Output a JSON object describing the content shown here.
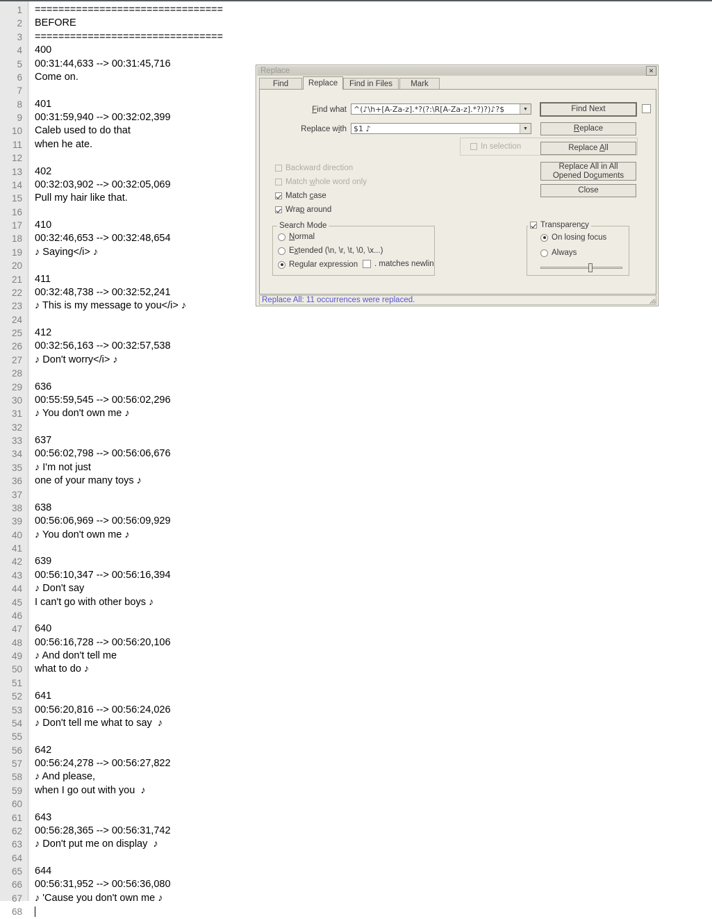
{
  "editor": {
    "lines": [
      {
        "n": 1,
        "text": "================================"
      },
      {
        "n": 2,
        "text": "BEFORE"
      },
      {
        "n": 3,
        "text": "================================"
      },
      {
        "n": 4,
        "text": "400"
      },
      {
        "n": 5,
        "text": "00:31:44,633 --> 00:31:45,716"
      },
      {
        "n": 6,
        "text": "Come on."
      },
      {
        "n": 7,
        "text": ""
      },
      {
        "n": 8,
        "text": "401"
      },
      {
        "n": 9,
        "text": "00:31:59,940 --> 00:32:02,399"
      },
      {
        "n": 10,
        "text": "Caleb used to do that"
      },
      {
        "n": 11,
        "text": "when he ate."
      },
      {
        "n": 12,
        "text": ""
      },
      {
        "n": 13,
        "text": "402"
      },
      {
        "n": 14,
        "text": "00:32:03,902 --> 00:32:05,069"
      },
      {
        "n": 15,
        "text": "Pull my hair like that."
      },
      {
        "n": 16,
        "text": ""
      },
      {
        "n": 17,
        "text": "410"
      },
      {
        "n": 18,
        "text": "00:32:46,653 --> 00:32:48,654"
      },
      {
        "n": 19,
        "text": "♪ Saying</i> ♪"
      },
      {
        "n": 20,
        "text": ""
      },
      {
        "n": 21,
        "text": "411"
      },
      {
        "n": 22,
        "text": "00:32:48,738 --> 00:32:52,241"
      },
      {
        "n": 23,
        "text": "♪ This is my message to you</i> ♪"
      },
      {
        "n": 24,
        "text": ""
      },
      {
        "n": 25,
        "text": "412"
      },
      {
        "n": 26,
        "text": "00:32:56,163 --> 00:32:57,538"
      },
      {
        "n": 27,
        "text": "♪ Don't worry</i> ♪"
      },
      {
        "n": 28,
        "text": ""
      },
      {
        "n": 29,
        "text": "636"
      },
      {
        "n": 30,
        "text": "00:55:59,545 --> 00:56:02,296"
      },
      {
        "n": 31,
        "text": "♪ You don't own me ♪"
      },
      {
        "n": 32,
        "text": ""
      },
      {
        "n": 33,
        "text": "637"
      },
      {
        "n": 34,
        "text": "00:56:02,798 --> 00:56:06,676"
      },
      {
        "n": 35,
        "text": "♪ I'm not just"
      },
      {
        "n": 36,
        "text": "one of your many toys ♪"
      },
      {
        "n": 37,
        "text": ""
      },
      {
        "n": 38,
        "text": "638"
      },
      {
        "n": 39,
        "text": "00:56:06,969 --> 00:56:09,929"
      },
      {
        "n": 40,
        "text": "♪ You don't own me ♪"
      },
      {
        "n": 41,
        "text": ""
      },
      {
        "n": 42,
        "text": "639"
      },
      {
        "n": 43,
        "text": "00:56:10,347 --> 00:56:16,394"
      },
      {
        "n": 44,
        "text": "♪ Don't say"
      },
      {
        "n": 45,
        "text": "I can't go with other boys ♪"
      },
      {
        "n": 46,
        "text": ""
      },
      {
        "n": 47,
        "text": "640"
      },
      {
        "n": 48,
        "text": "00:56:16,728 --> 00:56:20,106"
      },
      {
        "n": 49,
        "text": "♪ And don't tell me"
      },
      {
        "n": 50,
        "text": "what to do ♪"
      },
      {
        "n": 51,
        "text": ""
      },
      {
        "n": 52,
        "text": "641"
      },
      {
        "n": 53,
        "text": "00:56:20,816 --> 00:56:24,026"
      },
      {
        "n": 54,
        "text": "♪ Don't tell me what to say  ♪"
      },
      {
        "n": 55,
        "text": ""
      },
      {
        "n": 56,
        "text": "642"
      },
      {
        "n": 57,
        "text": "00:56:24,278 --> 00:56:27,822"
      },
      {
        "n": 58,
        "text": "♪ And please,"
      },
      {
        "n": 59,
        "text": "when I go out with you  ♪"
      },
      {
        "n": 60,
        "text": ""
      },
      {
        "n": 61,
        "text": "643"
      },
      {
        "n": 62,
        "text": "00:56:28,365 --> 00:56:31,742"
      },
      {
        "n": 63,
        "text": "♪ Don't put me on display  ♪"
      },
      {
        "n": 64,
        "text": ""
      },
      {
        "n": 65,
        "text": "644"
      },
      {
        "n": 66,
        "text": "00:56:31,952 --> 00:56:36,080"
      },
      {
        "n": 67,
        "text": "♪ 'Cause you don't own me ♪"
      },
      {
        "n": 68,
        "text": ""
      }
    ]
  },
  "dialog": {
    "title": "Replace",
    "close_glyph": "✕",
    "tabs": [
      {
        "label": "Find",
        "active": false
      },
      {
        "label": "Replace",
        "active": true
      },
      {
        "label": "Find in Files",
        "active": false
      },
      {
        "label": "Mark",
        "active": false
      }
    ],
    "find_what": {
      "label": "Find what",
      "value": "^(♪\\h+[A-Za-z].*?(?:\\R[A-Za-z].*?)?)♪?$",
      "arrow_glyph": "▼"
    },
    "replace_with": {
      "label": "Replace with",
      "value": "$1 ♪",
      "arrow_glyph": "▼"
    },
    "buttons": {
      "find_next": "Find Next",
      "replace": "Replace",
      "replace_all": "Replace All",
      "replace_all_opened_line1": "Replace All in All",
      "replace_all_opened_line2": "Opened Documents",
      "close": "Close"
    },
    "in_selection": {
      "label": "In selection",
      "checked": false,
      "disabled": true
    },
    "options": [
      {
        "label": "Backward direction",
        "checked": false,
        "disabled": true
      },
      {
        "label": "Match whole word only",
        "checked": false,
        "disabled": true
      },
      {
        "label": "Match case",
        "checked": true,
        "disabled": false
      },
      {
        "label": "Wrap around",
        "checked": true,
        "disabled": false
      }
    ],
    "search_mode": {
      "title": "Search Mode",
      "options": [
        {
          "label": "Normal",
          "selected": false
        },
        {
          "label": "Extended (\\n, \\r, \\t, \\0, \\x...)",
          "selected": false
        },
        {
          "label": "Regular expression",
          "selected": true
        }
      ],
      "dot_matches_newline": {
        "label": ". matches newline",
        "checked": false
      }
    },
    "transparency": {
      "label": "Transparency",
      "checked": true,
      "options": [
        {
          "label": "On losing focus",
          "selected": true
        },
        {
          "label": "Always",
          "selected": false
        }
      ],
      "slider_percent": 62
    },
    "status_message": "Replace All: 11 occurrences were replaced."
  },
  "colors": {
    "dialog_bg": "#efece4",
    "status_text": "#5555d0",
    "gutter_bg": "#e8e8e8",
    "line_number": "#808080"
  }
}
